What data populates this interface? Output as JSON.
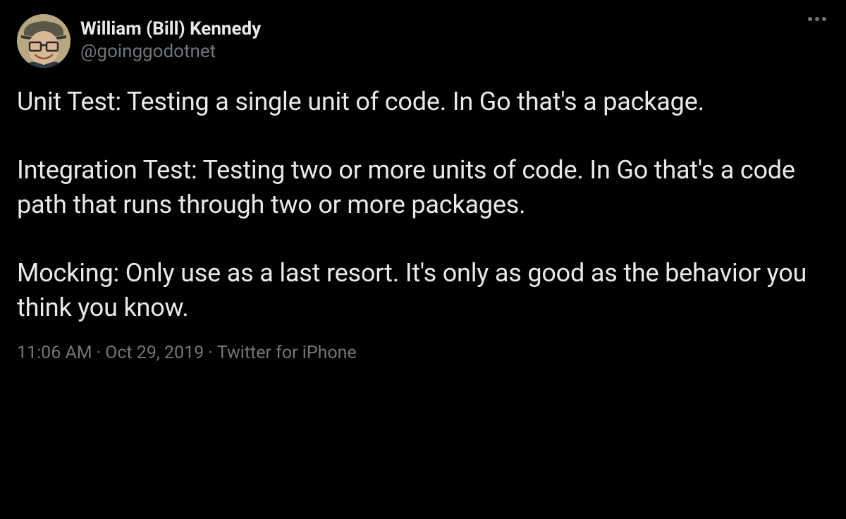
{
  "author": {
    "display_name": "William (Bill) Kennedy",
    "handle": "@goinggodotnet"
  },
  "tweet_text": "Unit Test: Testing a single unit of code. In Go that's a package.\n\nIntegration Test: Testing two or more units of code. In Go that's a code path that runs through two or more packages.\n\nMocking: Only use as a last resort. It's only as good as the behavior you think you know.",
  "meta": {
    "time": "11:06 AM",
    "date": "Oct 29, 2019",
    "source": "Twitter for iPhone",
    "separator": "·"
  }
}
